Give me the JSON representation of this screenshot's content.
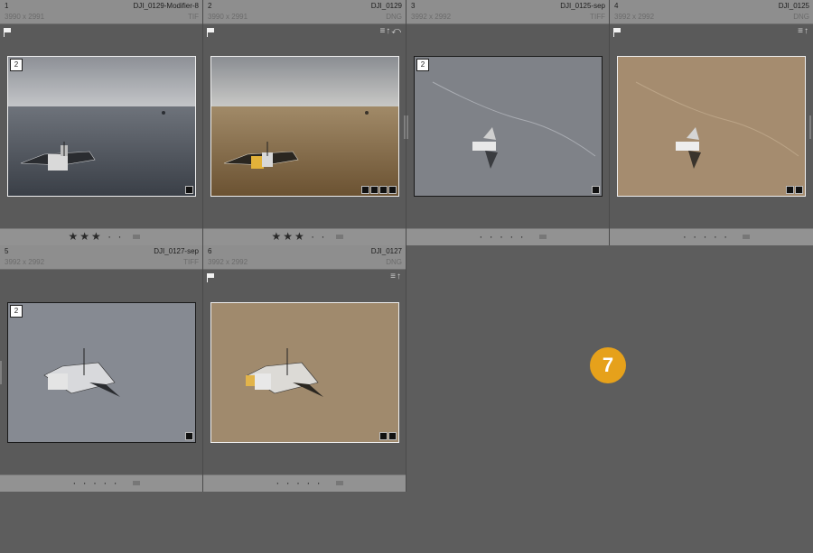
{
  "grid": {
    "cells": [
      {
        "index": "1",
        "dims": "3990 x 2991",
        "name": "DJI_0129-Modifier-8",
        "type": "TIF",
        "stack": "2",
        "stars": "★★★ · ·",
        "flag": true,
        "badges": ""
      },
      {
        "index": "2",
        "dims": "3990 x 2991",
        "name": "DJI_0129",
        "type": "DNG",
        "stack": "",
        "stars": "★★★ · ·",
        "flag": true,
        "badges": "≡↑⤺"
      },
      {
        "index": "3",
        "dims": "3992 x 2992",
        "name": "DJI_0125-sep",
        "type": "TIFF",
        "stack": "2",
        "stars": "· · · · ·",
        "flag": false,
        "badges": ""
      },
      {
        "index": "4",
        "dims": "3992 x 2992",
        "name": "DJI_0125",
        "type": "DNG",
        "stack": "",
        "stars": "· · · · ·",
        "flag": true,
        "badges": "≡↑"
      },
      {
        "index": "5",
        "dims": "3992 x 2992",
        "name": "DJI_0127-sep",
        "type": "TIFF",
        "stack": "2",
        "stars": "· · · · ·",
        "flag": false,
        "badges": ""
      },
      {
        "index": "6",
        "dims": "3992 x 2992",
        "name": "DJI_0127",
        "type": "DNG",
        "stack": "",
        "stars": "· · · · ·",
        "flag": true,
        "badges": "≡↑"
      }
    ]
  },
  "callout": {
    "label": "7",
    "color": "#e6a11b"
  },
  "icons": {
    "flag": "flag-icon",
    "metadata": "metadata-badge-icon",
    "crop": "crop-badge-icon",
    "develop": "develop-badge-icon",
    "comment": "comment-badge-icon"
  }
}
